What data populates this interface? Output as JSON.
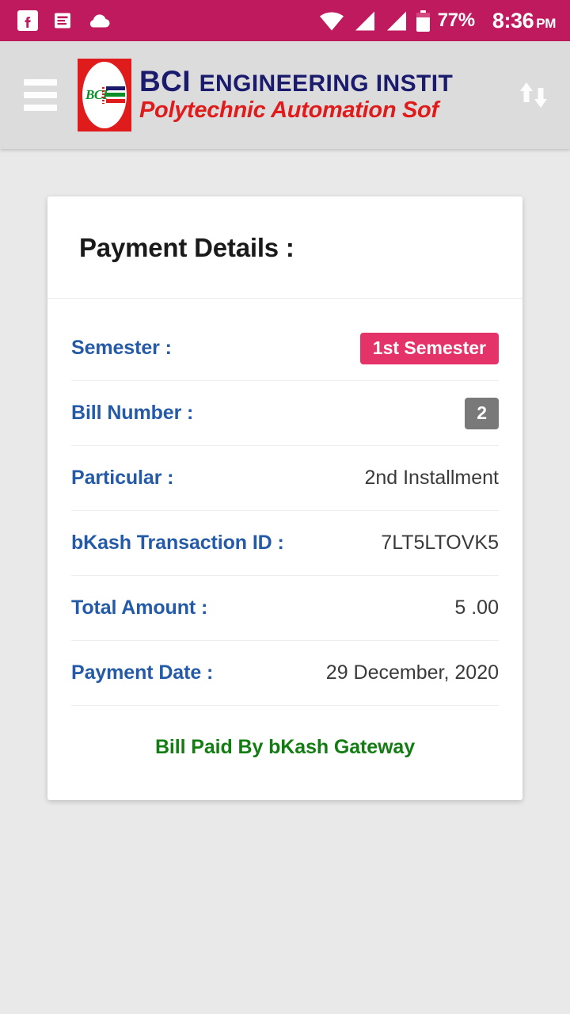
{
  "status_bar": {
    "background": "#bf1a5d",
    "left_icons": [
      "facebook-icon",
      "message-icon",
      "cloud-icon"
    ],
    "right_icons": [
      "wifi-icon",
      "signal-icon",
      "signal-icon",
      "battery-icon"
    ],
    "battery_percent": "77%",
    "time": "8:36",
    "am_pm": "PM"
  },
  "app_bar": {
    "menu_icon": "hamburger-menu-icon",
    "sort_icon": "sort-up-down-icon",
    "background": "#dcdcdc",
    "logo": {
      "mark_text": "BCI",
      "title": "BCI ENGINEERING INSTIT",
      "title_main": "BCI",
      "title_rest": "ENGINEERING INSTIT",
      "subtitle": "Polytechnic Automation Sof",
      "title_color": "#1b1b6e",
      "subtitle_color": "#e01b1b"
    }
  },
  "card": {
    "title": "Payment Details :",
    "rows": [
      {
        "label": "Semester :",
        "value": "1st Semester",
        "type": "badge-pink"
      },
      {
        "label": "Bill Number :",
        "value": "2",
        "type": "badge-gray"
      },
      {
        "label": "Particular :",
        "value": "2nd Installment",
        "type": "text"
      },
      {
        "label": "bKash Transaction ID :",
        "value": "7LT5LTOVK5",
        "type": "text"
      },
      {
        "label": "Total Amount :",
        "value": "5 .00",
        "type": "text"
      },
      {
        "label": "Payment Date :",
        "value": "29 December, 2020",
        "type": "text"
      }
    ],
    "footer_note": "Bill Paid By bKash Gateway",
    "footer_color": "#137d13",
    "label_color": "#245aa8",
    "badge_pink": "#e43368",
    "badge_gray": "#797979"
  }
}
